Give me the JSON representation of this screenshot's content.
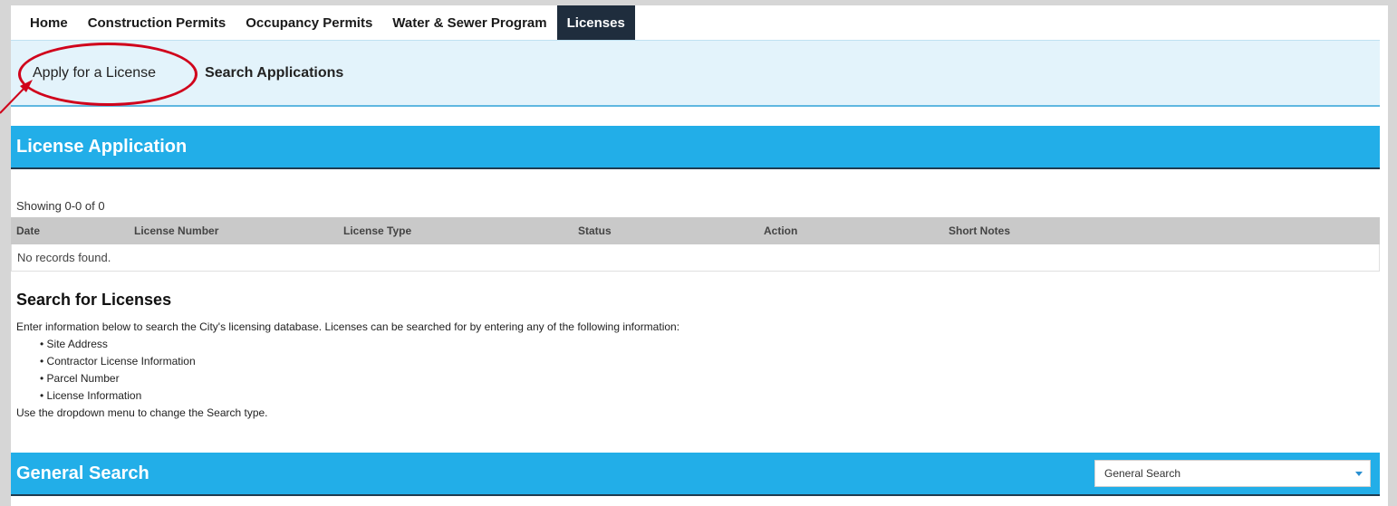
{
  "topnav": {
    "items": [
      "Home",
      "Construction Permits",
      "Occupancy Permits",
      "Water & Sewer Program",
      "Licenses"
    ],
    "active": "Licenses"
  },
  "subnav": {
    "apply": "Apply for a License",
    "search": "Search Applications"
  },
  "license_application": {
    "title": "License Application",
    "showing": "Showing 0-0 of 0",
    "columns": [
      "Date",
      "License Number",
      "License Type",
      "Status",
      "Action",
      "Short Notes"
    ],
    "empty": "No records found."
  },
  "search": {
    "title": "Search for Licenses",
    "intro": "Enter information below to search the City's licensing database. Licenses can be searched for by entering any of the following information:",
    "bullets": [
      "Site Address",
      "Contractor License Information",
      "Parcel Number",
      "License Information"
    ],
    "footer": "Use the dropdown menu to change the Search type."
  },
  "general_search": {
    "title": "General Search",
    "selected": "General Search"
  },
  "colors": {
    "accent": "#22aee8",
    "nav_active": "#1f2d3d",
    "highlight": "#d0021b"
  }
}
